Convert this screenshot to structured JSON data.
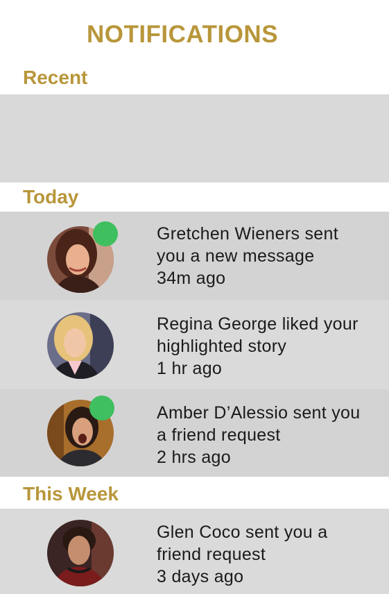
{
  "header": {
    "title": "NOTIFICATIONS"
  },
  "sections": {
    "recent": {
      "label": "Recent"
    },
    "today": {
      "label": "Today"
    },
    "this_week": {
      "label": "This Week"
    }
  },
  "colors": {
    "accent": "#b8963a",
    "online": "#3fbf5f",
    "row_bg": "#d9d9d9"
  },
  "notifications": [
    {
      "line1": "Gretchen Wieners sent",
      "line2": "you a new message",
      "time": "34m ago",
      "online": true,
      "avatar": "avatar-gretchen"
    },
    {
      "line1": "Regina George liked your",
      "line2": "highlighted story",
      "time": "1 hr ago",
      "online": false,
      "avatar": "avatar-regina"
    },
    {
      "line1": "Amber D’Alessio sent you",
      "line2": "a friend request",
      "time": "2 hrs ago",
      "online": true,
      "avatar": "avatar-amber"
    },
    {
      "line1": "Glen Coco sent you a",
      "line2": "friend request",
      "time": "3 days ago",
      "online": false,
      "avatar": "avatar-glen"
    }
  ]
}
